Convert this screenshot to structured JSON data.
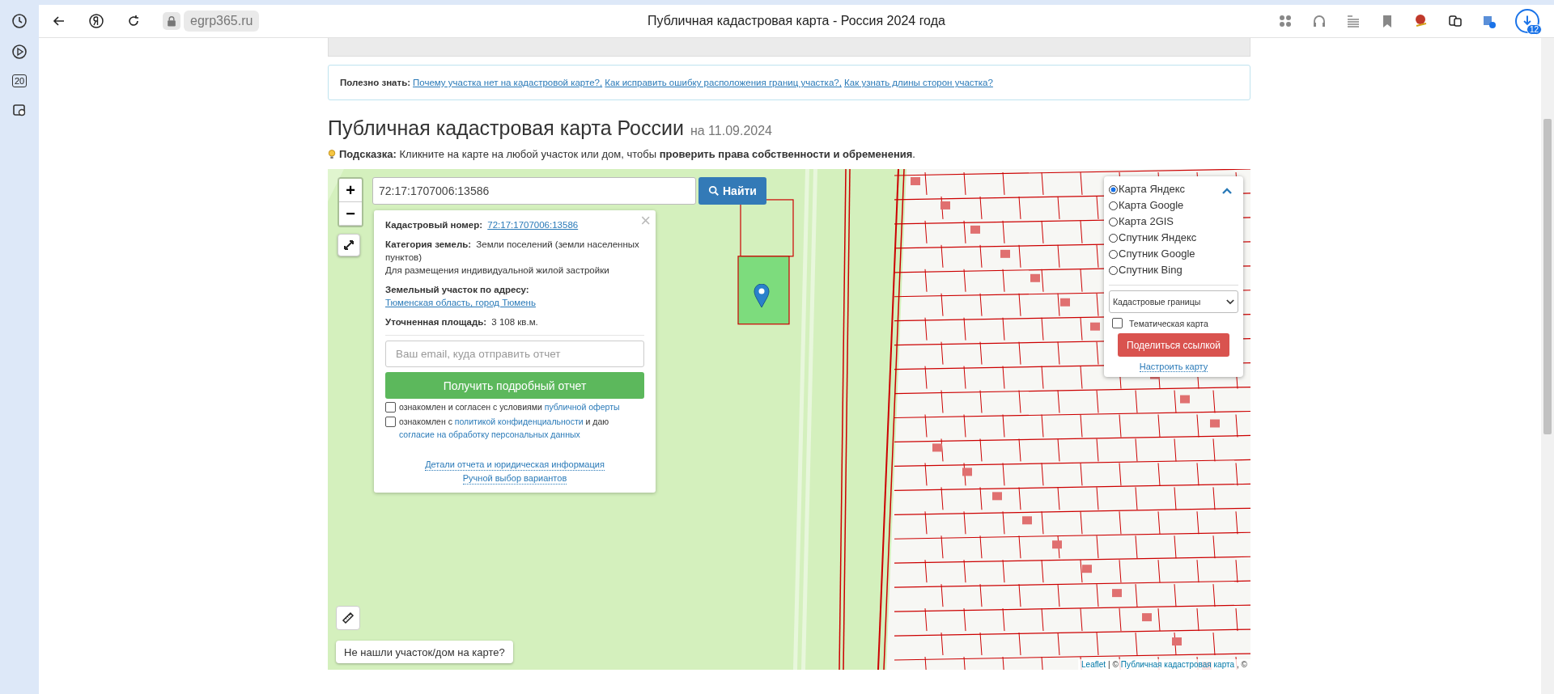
{
  "browser": {
    "address": "egrp365.ru",
    "title": "Публичная кадастровая карта - Россия 2024 года",
    "downloads_badge": "12",
    "sidebar_badge": "20"
  },
  "info": {
    "label": "Полезно знать:",
    "links": [
      "Почему участка нет на кадастровой карте?,",
      "Как исправить ошибку расположения границ участка?,",
      "Как узнать длины сторон участка?"
    ]
  },
  "heading": {
    "title": "Публичная кадастровая карта России",
    "date": "на 11.09.2024"
  },
  "hint": "**Подсказка:** Кликните на карте на любой участок или дом, чтобы **проверить права собственности и обременения**.",
  "map": {
    "zoom_in": "+",
    "zoom_out": "−",
    "search_value": "72:17:1707006:13586",
    "search_button": "Найти",
    "not_found_button": "Не нашли участок/дом на карте?",
    "attribution_link": "Leaflet",
    "attribution_text": "| ©",
    "attribution_link2": "Публичная кадастровая карта",
    "attribution_tail": ", ©"
  },
  "popup": {
    "close": "×",
    "fields": [
      {
        "label": "Кадастровый номер:",
        "value": "72:17:1707006:13586",
        "kind": "link"
      },
      {
        "label": "Категория земель:",
        "value": "Земли поселений (земли населенных пунктов)",
        "extra": "Для размещения индивидуальной жилой застройки",
        "kind": "text"
      },
      {
        "label": "Земельный участок по адресу:",
        "value": "Тюменская область, город Тюмень",
        "kind": "link"
      },
      {
        "label": "Уточненная площадь:",
        "value": "3 108 кв.м.",
        "kind": "text"
      }
    ],
    "email_placeholder": "Ваш email, куда отправить отчет",
    "report_button": "Получить подробный отчет",
    "agreements": [
      {
        "checked": false,
        "parts": [
          {
            "text": "ознакомлен и согласен с условиями",
            "kind": "text"
          },
          {
            "text": "публичной оферты",
            "kind": "link"
          }
        ]
      },
      {
        "checked": false,
        "parts": [
          {
            "text": "ознакомлен с",
            "kind": "text"
          },
          {
            "text": "политикой конфиденциальности",
            "kind": "link"
          },
          {
            "text": "и даю",
            "kind": "text"
          },
          {
            "text": "согласие на обработку персональных данных",
            "kind": "link"
          }
        ]
      }
    ],
    "footer_links": [
      "Детали отчета и юридическая информация",
      "Ручной выбор вариантов"
    ]
  },
  "layers": {
    "options": [
      {
        "label": "Карта Яндекс",
        "selected": true
      },
      {
        "label": "Карта Google",
        "selected": false
      },
      {
        "label": "Карта 2GIS",
        "selected": false
      },
      {
        "label": "Спутник Яндекс",
        "selected": false
      },
      {
        "label": "Спутник Google",
        "selected": false
      },
      {
        "label": "Спутник Bing",
        "selected": false
      }
    ],
    "overlay_select": "Кадастровые границы",
    "thematic": {
      "label": "Тематическая карта",
      "checked": false
    },
    "share_button": "Поделиться ссылкой",
    "settings_link": "Настроить карту"
  }
}
